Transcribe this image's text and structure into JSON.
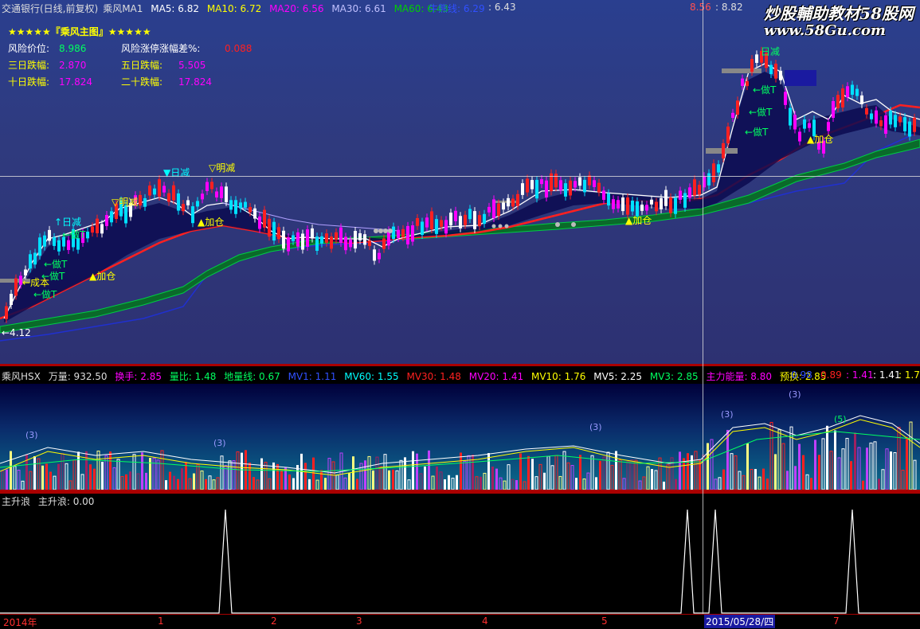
{
  "main": {
    "stock_title": "交通银行(日线,前复权)",
    "formula": "乘风MA1",
    "ma5_label": "MA5: 6.82",
    "ma10_label": "MA10: 6.72",
    "ma20_label": "MA20: 6.56",
    "ma30_label": "MA30: 6.61",
    "ma60_label": "MA60: 6.43",
    "right_label_1": "牛熊线: 6.29",
    "right_label_2": ": 6.43",
    "right_val_1": "8.56",
    "right_val_2": ": 8.82",
    "info": {
      "title": "★★★★★『乘风主图』★★★★★",
      "risk_price_label": "风险价位:",
      "risk_price_value": "8.986",
      "risk_spread_label": "风险涨停涨幅差%:",
      "risk_spread_value": "0.088",
      "day3_label": "三日跌幅:",
      "day3_value": "2.870",
      "day5_label": "五日跌幅:",
      "day5_value": "5.505",
      "day10_label": "十日跌幅:",
      "day10_value": "17.824",
      "day20_label": "二十跌幅:",
      "day20_value": "17.824"
    },
    "annotations": {
      "low_price": "←4.12",
      "pout": "↑日减",
      "mingjian1": "▽明减",
      "rijian1": "▼日减",
      "mingjian2": "▽明减",
      "rijian2": "▼日减",
      "zuot1": "←做T",
      "zuot2": "←做T",
      "zuot3": "←做T",
      "zuot4": "←做T",
      "chengben": "←成本",
      "jiacang1": "▲加仓",
      "jiacang2": "▲加仓",
      "jiacang3": "▲加仓",
      "jiacang4": "▲加仓",
      "zuot5": "←做T",
      "zuot6": "←做T",
      "zuot7": "←做T",
      "rijian3": "日减"
    }
  },
  "watermark": {
    "line1": "炒股輔助教材58股网",
    "line2": "www.58Gu.com"
  },
  "volume": {
    "name": "乘风HSX",
    "wanliang": "万量: 932.50",
    "huanshou": "换手: 2.85",
    "liangbi": "量比: 1.48",
    "diliangxian": "地量线: 0.67",
    "mv1": "MV1: 1.11",
    "mv60": "MV60: 1.55",
    "mv30": "MV30: 1.48",
    "mv20": "MV20: 1.41",
    "mv10": "MV10: 1.76",
    "mv5": "MV5: 2.25",
    "mv3": "MV3: 2.85",
    "zhuli": "主力能量: 8.80",
    "yuhuan": "预换: 2.85",
    "r1": "0.98",
    "r2": "0.89",
    "r3": ": 1.41",
    "r4": ": 1.41",
    "r5": ": 1.76",
    "marks": [
      "(3)",
      "(3)",
      "(3)",
      "(3)",
      "(3)",
      "(5)"
    ]
  },
  "indicator": {
    "name": "主升浪",
    "value_label": "主升浪: 0.00"
  },
  "xaxis": {
    "year": "2014年",
    "m1": "1",
    "m2": "2",
    "m3": "3",
    "m4": "4",
    "m5": "5",
    "date": "2015/05/28/四",
    "m7": "7"
  },
  "colors": {
    "up": "#ff3030",
    "down": "#00e0ff",
    "magenta": "#ff00ff",
    "ma5": "#ffffff",
    "ma10": "#ffff00",
    "ma20": "#ff00ff",
    "ma60": "#00aa00"
  }
}
